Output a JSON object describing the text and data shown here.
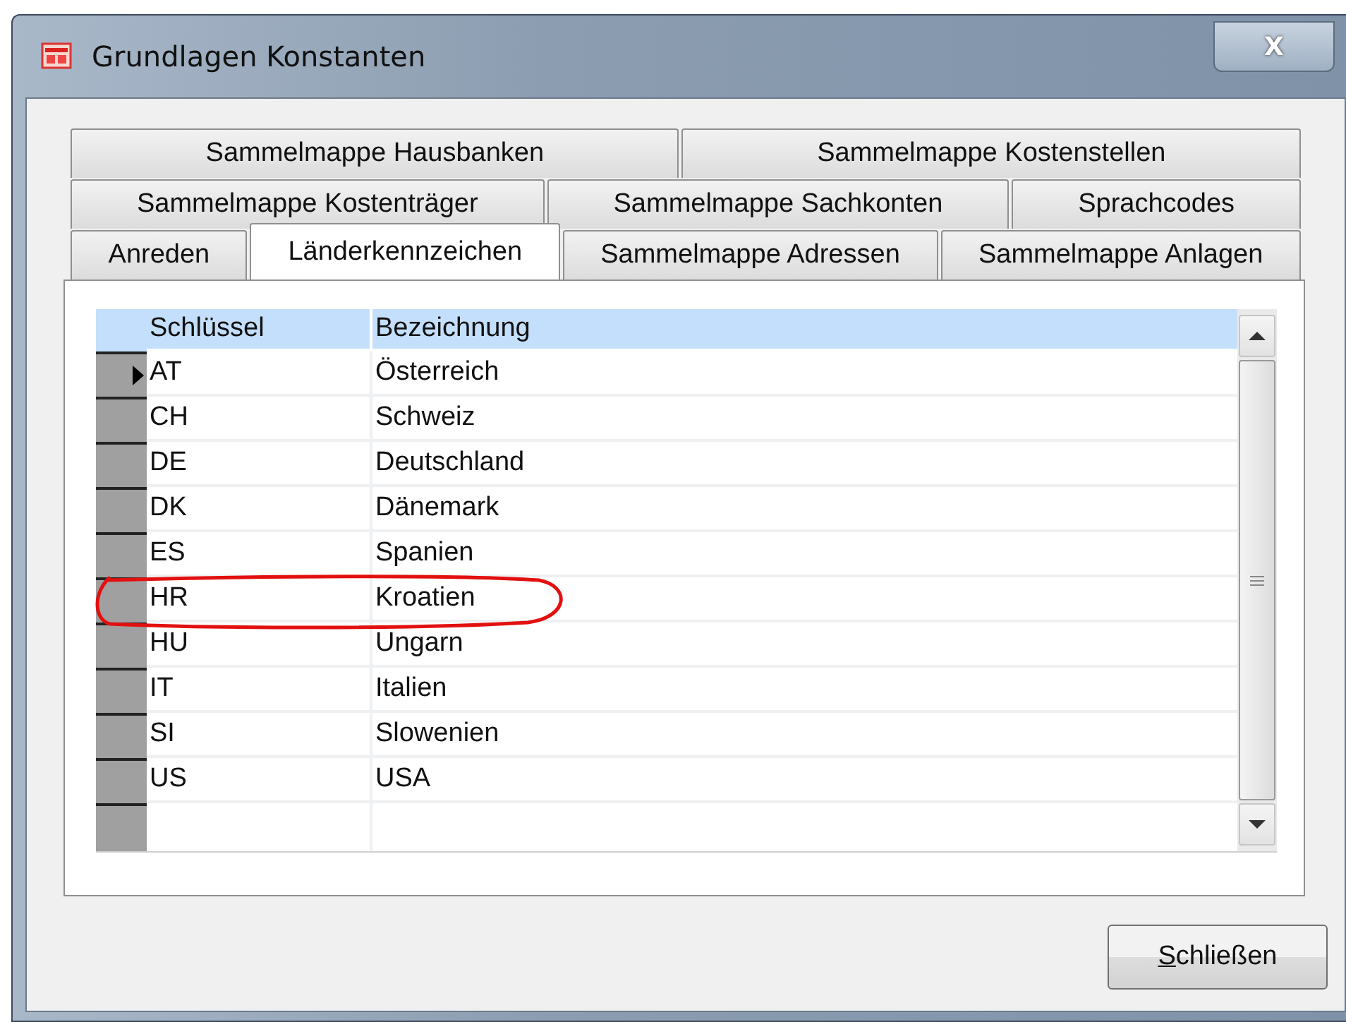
{
  "window": {
    "title": "Grundlagen Konstanten",
    "close_label": "X"
  },
  "tab_rows": [
    [
      {
        "label": "Sammelmappe Hausbanken",
        "selected": false
      },
      {
        "label": "Sammelmappe Kostenstellen",
        "selected": false
      }
    ],
    [
      {
        "label": "Sammelmappe Kostenträger",
        "selected": false
      },
      {
        "label": "Sammelmappe Sachkonten",
        "selected": false
      },
      {
        "label": "Sprachcodes",
        "selected": false
      }
    ],
    [
      {
        "label": "Anreden",
        "selected": false
      },
      {
        "label": "Länderkennzeichen",
        "selected": true
      },
      {
        "label": "Sammelmappe Adressen",
        "selected": false
      },
      {
        "label": "Sammelmappe Anlagen",
        "selected": false
      }
    ]
  ],
  "table": {
    "columns": [
      "Schlüssel",
      "Bezeichnung"
    ],
    "rows": [
      {
        "cells": [
          "AT",
          "Österreich"
        ],
        "selected": true
      },
      {
        "cells": [
          "CH",
          "Schweiz"
        ],
        "selected": false
      },
      {
        "cells": [
          "DE",
          "Deutschland"
        ],
        "selected": false
      },
      {
        "cells": [
          "DK",
          "Dänemark"
        ],
        "selected": false
      },
      {
        "cells": [
          "ES",
          "Spanien"
        ],
        "selected": false
      },
      {
        "cells": [
          "HR",
          "Kroatien"
        ],
        "selected": false
      },
      {
        "cells": [
          "HU",
          "Ungarn"
        ],
        "selected": false
      },
      {
        "cells": [
          "IT",
          "Italien"
        ],
        "selected": false
      },
      {
        "cells": [
          "SI",
          "Slowenien"
        ],
        "selected": false
      },
      {
        "cells": [
          "US",
          "USA"
        ],
        "selected": false
      }
    ]
  },
  "buttons": [
    {
      "label": "Schließen"
    }
  ]
}
